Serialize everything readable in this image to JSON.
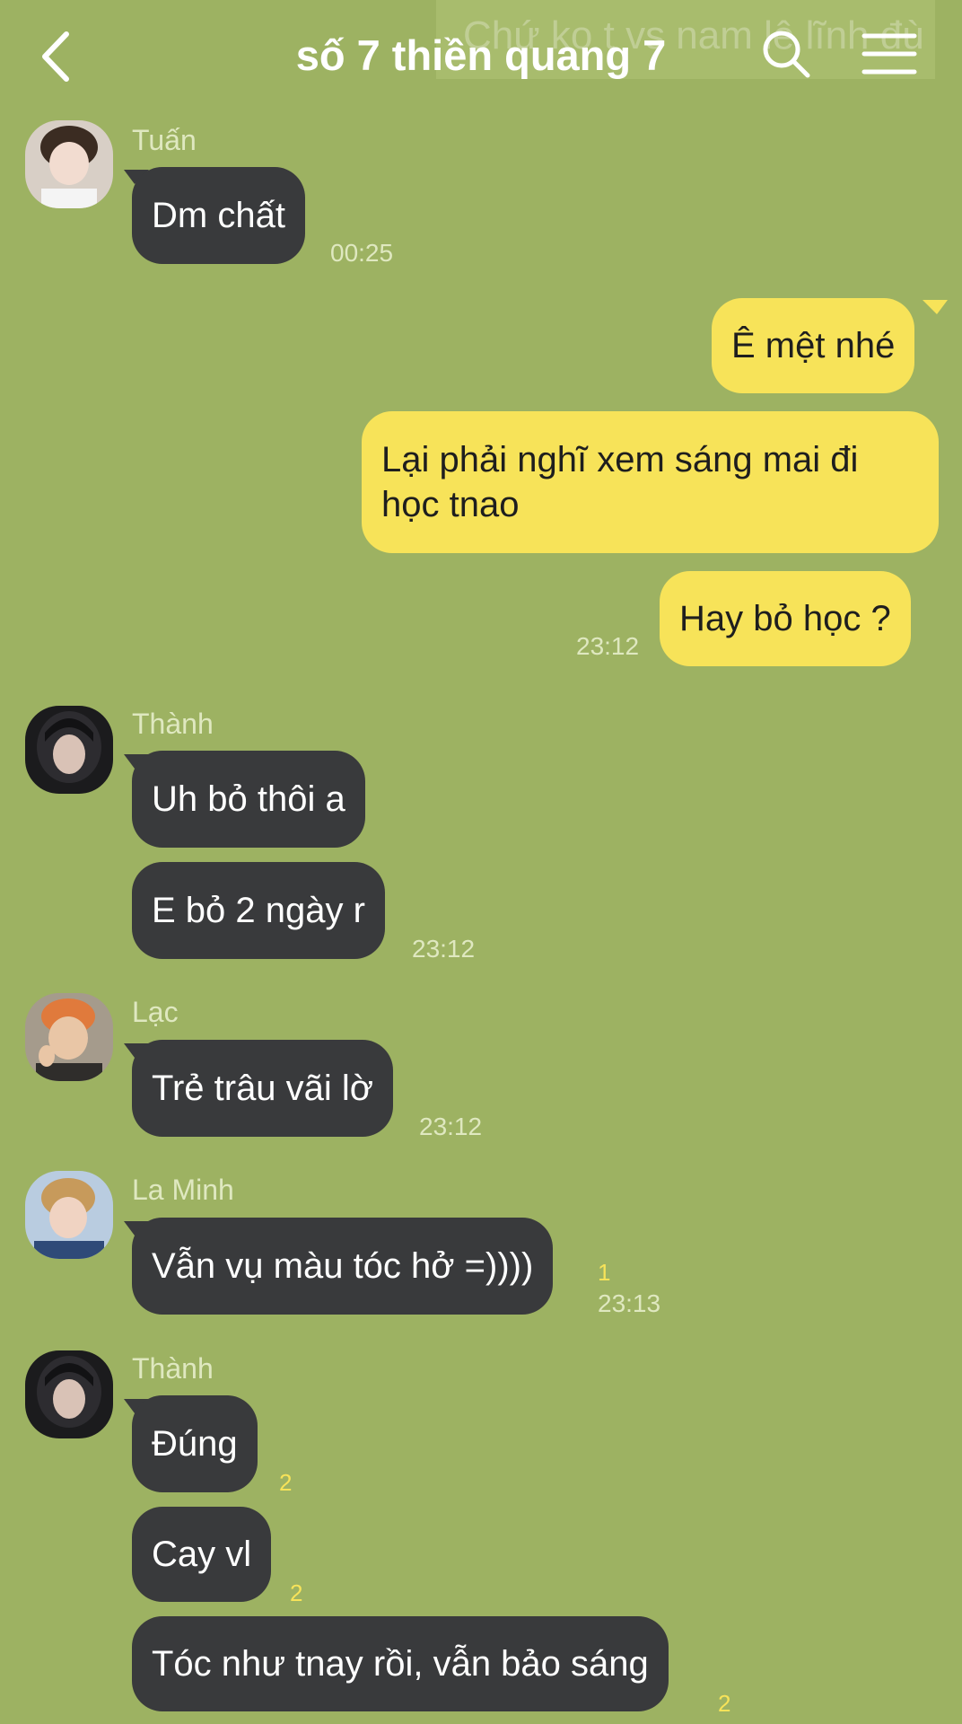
{
  "header": {
    "title": "số 7 thiền quang 7",
    "ghost_text": "Chứ ko t vs nam lê lĩnh đù"
  },
  "icons": {
    "back": "chevron-left-icon",
    "search": "search-icon",
    "menu": "hamburger-menu-icon"
  },
  "colors": {
    "background": "#9db262",
    "incoming_bubble": "#393a3c",
    "outgoing_bubble": "#f7e359",
    "meta_text": "#dfe8c0",
    "unread_count": "#f7e359"
  },
  "messages": {
    "g1": {
      "sender": "Tuấn",
      "m1": {
        "text": "Dm chất",
        "time": "00:25"
      }
    },
    "g2": {
      "m1": {
        "text": "Ê mệt nhé"
      },
      "m2": {
        "line1": "Lại phải nghĩ xem sáng mai đi",
        "line2": "học tnao"
      },
      "m3": {
        "text": "Hay bỏ học ?",
        "time": "23:12"
      }
    },
    "g3": {
      "sender": "Thành",
      "m1": {
        "text": "Uh bỏ thôi a"
      },
      "m2": {
        "text": "E bỏ 2 ngày r",
        "time": "23:12"
      }
    },
    "g4": {
      "sender": "Lạc",
      "m1": {
        "text": "Trẻ trâu vãi lờ",
        "time": "23:12"
      }
    },
    "g5": {
      "sender": "La Minh",
      "m1": {
        "text": "Vẫn vụ màu tóc hở =))))",
        "unread": "1",
        "time": "23:13"
      }
    },
    "g6": {
      "sender": "Thành",
      "m1": {
        "text": "Đúng",
        "unread": "2"
      },
      "m2": {
        "text": "Cay vl",
        "unread": "2"
      },
      "m3": {
        "text": "Tóc như tnay rồi, vẫn bảo sáng",
        "unread": "2"
      }
    }
  }
}
